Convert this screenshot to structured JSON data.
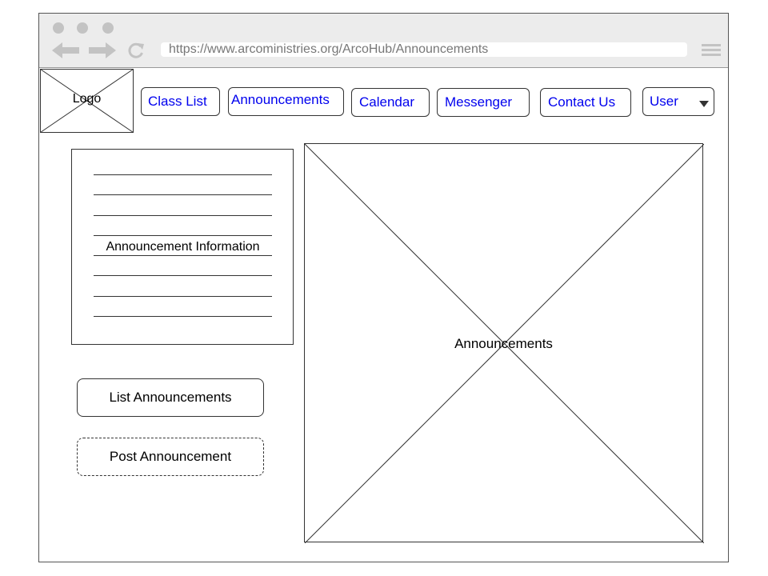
{
  "browser": {
    "url": "https://www.arcoministries.org/ArcoHub/Announcements",
    "icons": [
      "window-dot-icon",
      "back-arrow-icon",
      "forward-arrow-icon",
      "reload-icon",
      "hamburger-menu-icon"
    ]
  },
  "header": {
    "logo_label": "Logo",
    "nav": [
      {
        "label": "Class List"
      },
      {
        "label": "Announcements"
      },
      {
        "label": "Calendar"
      },
      {
        "label": "Messenger"
      },
      {
        "label": "Contact Us"
      },
      {
        "label": "User"
      }
    ]
  },
  "sidebar": {
    "info_title": "Announcement Information",
    "list_button": "List Announcements",
    "post_button": "Post Announcement"
  },
  "main": {
    "placeholder_label": "Announcements"
  },
  "colors": {
    "link": "#0000ee",
    "chrome": "#ececec",
    "chrome_icon": "#c3c3c3",
    "border": "#333333"
  }
}
